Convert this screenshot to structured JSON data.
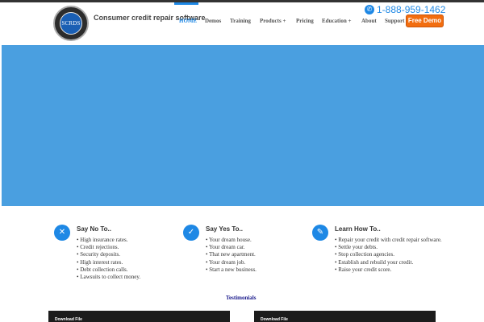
{
  "header": {
    "logo_text": "SCRDS",
    "tagline": "Consumer credit repair software",
    "phone": "1-888-959-1462",
    "demo_button": "Free Demo"
  },
  "nav": {
    "items": [
      {
        "label": "HOME"
      },
      {
        "label": "Demos"
      },
      {
        "label": "Training"
      },
      {
        "label": "Products +"
      },
      {
        "label": "Pricing"
      },
      {
        "label": "Education +"
      },
      {
        "label": "About"
      },
      {
        "label": "Support"
      }
    ]
  },
  "icons": {
    "phone": "phone-icon",
    "say_no": "x-icon",
    "say_yes": "check-icon",
    "learn": "pencil-icon"
  },
  "colors": {
    "accent": "#1e88e5",
    "hero": "#4a9fe0",
    "demo_button": "#f26d0f"
  },
  "features": [
    {
      "title": "Say No To..",
      "items": [
        "• High insurance rates.",
        "• Credit rejections.",
        "• Security deposits.",
        "• High interest rates.",
        "• Debt collection calls.",
        "• Lawsuits to collect money."
      ]
    },
    {
      "title": "Say Yes To..",
      "items": [
        "• Your dream house.",
        "• Your dream car.",
        "• That new apartment.",
        "• Your dream job.",
        "• Start a new business."
      ]
    },
    {
      "title": "Learn How To..",
      "items": [
        "• Repair your credit with credit repair     software.",
        "• Settle your debts.",
        "• Stop collection agencies.",
        "• Establish and rebuild your credit.",
        "• Raise your credit score."
      ]
    }
  ],
  "testimonials_label": "Testimonials",
  "downloads": [
    {
      "label": "Download File"
    },
    {
      "label": "Download File"
    }
  ]
}
